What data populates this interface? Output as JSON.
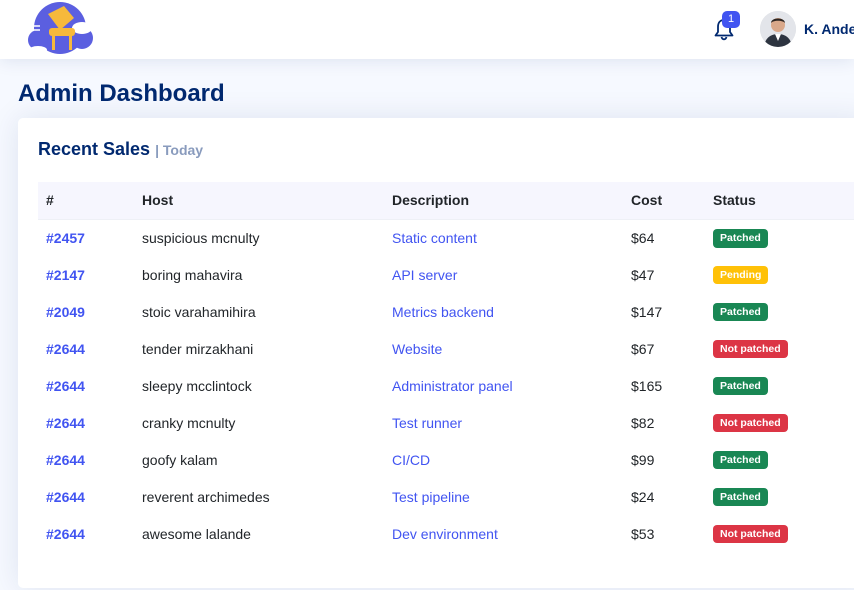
{
  "header": {
    "notifications_count": "1",
    "user_name": "K. Ande"
  },
  "page_title": "Admin Dashboard",
  "card": {
    "title": "Recent Sales",
    "subtitle": "| Today"
  },
  "table": {
    "columns": [
      "#",
      "Host",
      "Description",
      "Cost",
      "Status"
    ],
    "rows": [
      {
        "id": "#2457",
        "host": "suspicious mcnulty",
        "description": "Static content",
        "cost": "$64",
        "status": "Patched",
        "status_type": "success"
      },
      {
        "id": "#2147",
        "host": "boring mahavira",
        "description": "API server",
        "cost": "$47",
        "status": "Pending",
        "status_type": "warning"
      },
      {
        "id": "#2049",
        "host": "stoic varahamihira",
        "description": "Metrics backend",
        "cost": "$147",
        "status": "Patched",
        "status_type": "success"
      },
      {
        "id": "#2644",
        "host": "tender mirzakhani",
        "description": "Website",
        "cost": "$67",
        "status": "Not patched",
        "status_type": "danger"
      },
      {
        "id": "#2644",
        "host": "sleepy mcclintock",
        "description": "Administrator panel",
        "cost": "$165",
        "status": "Patched",
        "status_type": "success"
      },
      {
        "id": "#2644",
        "host": "cranky mcnulty",
        "description": "Test runner",
        "cost": "$82",
        "status": "Not patched",
        "status_type": "danger"
      },
      {
        "id": "#2644",
        "host": "goofy kalam",
        "description": "CI/CD",
        "cost": "$99",
        "status": "Patched",
        "status_type": "success"
      },
      {
        "id": "#2644",
        "host": "reverent archimedes",
        "description": "Test pipeline",
        "cost": "$24",
        "status": "Patched",
        "status_type": "success"
      },
      {
        "id": "#2644",
        "host": "awesome lalande",
        "description": "Dev environment",
        "cost": "$53",
        "status": "Not patched",
        "status_type": "danger"
      }
    ]
  },
  "colors": {
    "accent": "#4154f1",
    "heading": "#012970",
    "success": "#198754",
    "warning": "#ffc107",
    "danger": "#dc3545"
  }
}
